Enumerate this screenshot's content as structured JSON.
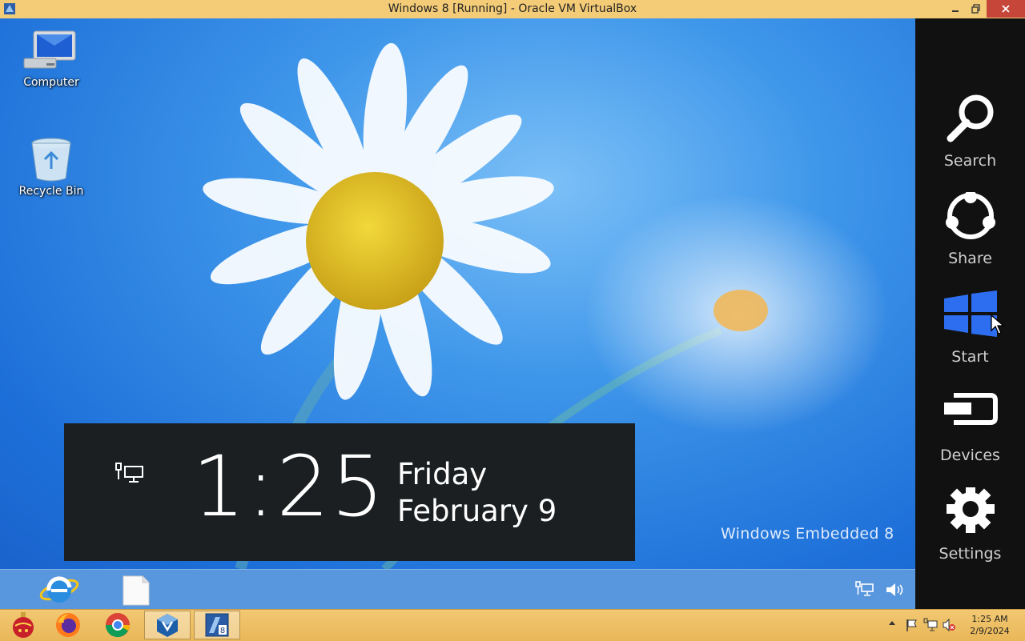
{
  "window": {
    "title": "Windows 8 [Running] - Oracle VM VirtualBox"
  },
  "desktop": {
    "icons": [
      {
        "label": "Computer"
      },
      {
        "label": "Recycle Bin"
      }
    ],
    "watermark": "Windows Embedded 8"
  },
  "clock_panel": {
    "time": "1:25",
    "day": "Friday",
    "date": "February 9"
  },
  "charms": [
    {
      "label": "Search",
      "icon": "search-icon"
    },
    {
      "label": "Share",
      "icon": "share-icon"
    },
    {
      "label": "Start",
      "icon": "windows-logo-icon"
    },
    {
      "label": "Devices",
      "icon": "devices-icon"
    },
    {
      "label": "Settings",
      "icon": "gear-icon"
    }
  ],
  "guest_taskbar": {
    "pinned": [
      "internet-explorer-icon",
      "blank-document-icon"
    ],
    "tray": [
      "network-icon",
      "speaker-icon"
    ]
  },
  "host_taskbar": {
    "apps": [
      "ornament-app-icon",
      "firefox-icon",
      "chrome-icon",
      "virtualbox-icon",
      "windows8-vm-icon"
    ],
    "tray": [
      "show-hidden-icons-arrow",
      "action-center-flag-icon",
      "network-icon",
      "muted-speaker-icon"
    ],
    "clock": {
      "time": "1:25 AM",
      "date": "2/9/2024"
    }
  },
  "colors": {
    "charms_bg": "#111111",
    "host_taskbar": "#f0c36c",
    "start_blue": "#2d6ef0",
    "close_red": "#c7463a"
  }
}
